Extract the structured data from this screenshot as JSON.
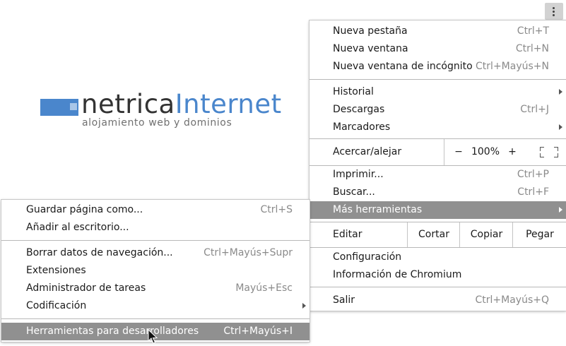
{
  "logo": {
    "word_dark": "netrica",
    "word_blue": "Internet",
    "tagline": "alojamiento web y dominios"
  },
  "colors": {
    "accent": "#4a86cc",
    "highlight": "#909090"
  },
  "toolbar": {
    "menu_icon": "vertical-dots-icon"
  },
  "main_menu": {
    "new_tab": {
      "label": "Nueva pestaña",
      "shortcut": "Ctrl+T"
    },
    "new_window": {
      "label": "Nueva ventana",
      "shortcut": "Ctrl+N"
    },
    "incognito": {
      "label": "Nueva ventana de incógnito",
      "shortcut": "Ctrl+Mayús+N"
    },
    "history": {
      "label": "Historial"
    },
    "downloads": {
      "label": "Descargas",
      "shortcut": "Ctrl+J"
    },
    "bookmarks": {
      "label": "Marcadores"
    },
    "zoom": {
      "label": "Acercar/alejar",
      "minus": "−",
      "value": "100%",
      "plus": "+"
    },
    "print": {
      "label": "Imprimir...",
      "shortcut": "Ctrl+P"
    },
    "find": {
      "label": "Buscar...",
      "shortcut": "Ctrl+F"
    },
    "more_tools": {
      "label": "Más herramientas"
    },
    "edit": {
      "label": "Editar",
      "cut": "Cortar",
      "copy": "Copiar",
      "paste": "Pegar"
    },
    "settings": {
      "label": "Configuración"
    },
    "about": {
      "label": "Información de Chromium"
    },
    "exit": {
      "label": "Salir",
      "shortcut": "Ctrl+Mayús+Q"
    }
  },
  "sub_menu": {
    "save_page": {
      "label": "Guardar página como...",
      "shortcut": "Ctrl+S"
    },
    "add_desktop": {
      "label": "Añadir al escritorio..."
    },
    "clear_data": {
      "label": "Borrar datos de navegación...",
      "shortcut": "Ctrl+Mayús+Supr"
    },
    "extensions": {
      "label": "Extensiones"
    },
    "task_manager": {
      "label": "Administrador de tareas",
      "shortcut": "Mayús+Esc"
    },
    "encoding": {
      "label": "Codificación"
    },
    "dev_tools": {
      "label": "Herramientas para desarrolladores",
      "shortcut": "Ctrl+Mayús+I"
    }
  }
}
